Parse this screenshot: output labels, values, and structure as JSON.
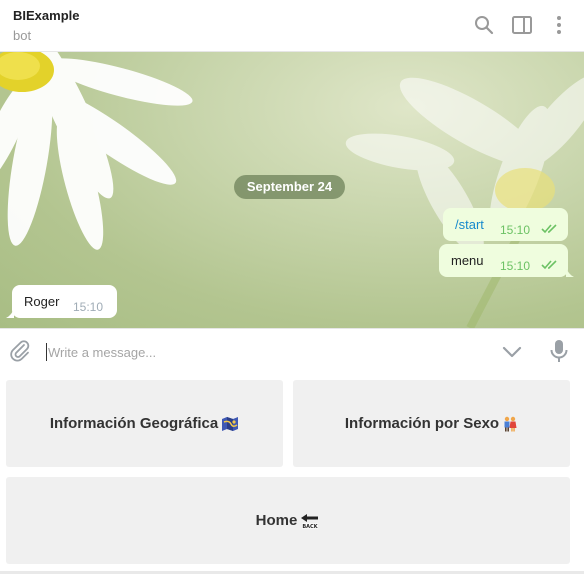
{
  "header": {
    "title": "BIExample",
    "subtitle": "bot",
    "icons": [
      "search-icon",
      "sidebar-toggle-icon",
      "more-vertical-icon"
    ]
  },
  "chat": {
    "date_badge": "September 24",
    "messages": [
      {
        "direction": "outgoing",
        "text": "/start",
        "time": "15:10",
        "status": "read"
      },
      {
        "direction": "outgoing",
        "text": "menu",
        "time": "15:10",
        "status": "read"
      },
      {
        "direction": "incoming",
        "text": "Roger",
        "time": "15:10"
      }
    ]
  },
  "composer": {
    "placeholder": "Write a message...",
    "value": "",
    "icons": [
      "paperclip-icon",
      "chevron-down-icon",
      "microphone-icon"
    ]
  },
  "keyboard": {
    "buttons": [
      {
        "label": "Información Geográfica",
        "icon": "map-icon"
      },
      {
        "label": "Información por Sexo",
        "icon": "couple-icon"
      },
      {
        "label": "Home",
        "icon": "back-arrow-icon"
      }
    ]
  },
  "colors": {
    "outgoing_bubble": "#effdde",
    "incoming_bubble": "#ffffff",
    "link": "#168acd",
    "read_check": "#6cc264"
  }
}
